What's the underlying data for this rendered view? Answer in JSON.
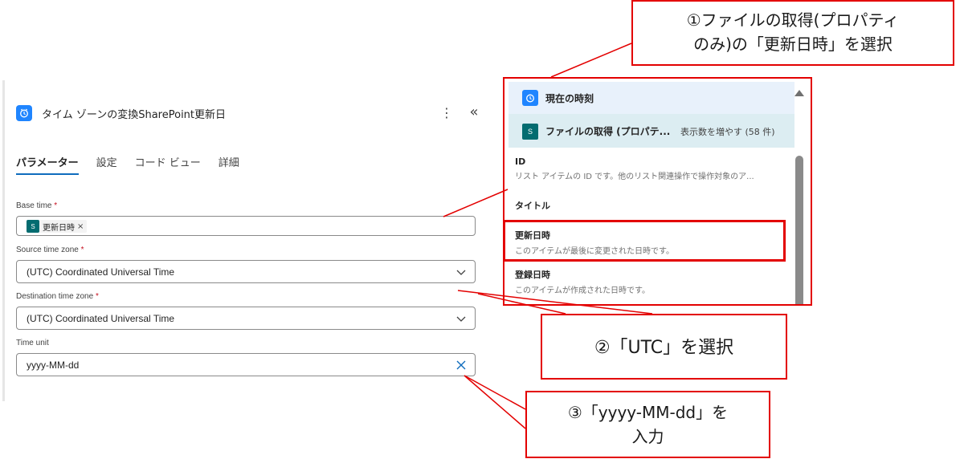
{
  "action": {
    "title": "タイム ゾーンの変換SharePoint更新日",
    "icon": "clock-icon"
  },
  "tabs": [
    "パラメーター",
    "設定",
    "コード ビュー",
    "詳細"
  ],
  "fields": {
    "base_time": {
      "label": "Base time",
      "required": "*",
      "token": "更新日時"
    },
    "source_tz": {
      "label": "Source time zone",
      "required": "*",
      "value": "(UTC) Coordinated Universal Time"
    },
    "dest_tz": {
      "label": "Destination time zone",
      "required": "*",
      "value": "(UTC) Coordinated Universal Time"
    },
    "time_unit": {
      "label": "Time unit",
      "value": "yyyy-MM-dd"
    }
  },
  "popup": {
    "group1_title": "現在の時刻",
    "group2_title": "ファイルの取得 (プロパテ...",
    "group2_more": "表示数を増やす (58 件)",
    "items": [
      {
        "title": "ID",
        "desc": "リスト アイテムの ID です。他のリスト関連操作で操作対象のア..."
      },
      {
        "title": "タイトル",
        "desc": ""
      },
      {
        "title": "更新日時",
        "desc": "このアイテムが最後に変更された日時です。"
      },
      {
        "title": "登録日時",
        "desc": "このアイテムが作成された日時です。"
      }
    ]
  },
  "callouts": {
    "c1_line1": "①ファイルの取得(プロパティ",
    "c1_line2": "のみ)の「更新日時」を選択",
    "c2": "②「UTC」を選択",
    "c3_line1": "③「yyyy-MM-dd」を",
    "c3_line2": "入力"
  },
  "colors": {
    "accent_red": "#e30000",
    "brand_blue": "#1f85ff",
    "sharepoint_teal": "#036c70"
  }
}
